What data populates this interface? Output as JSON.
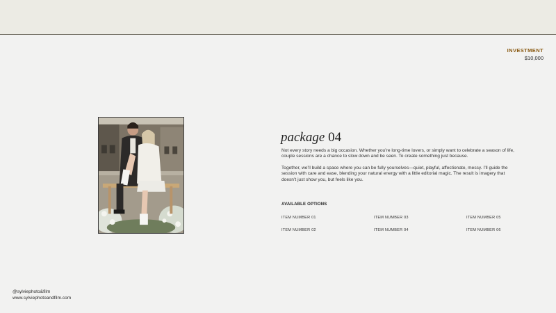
{
  "investment": {
    "label": "INVESTMENT",
    "price": "$10,000"
  },
  "package": {
    "title_script": "package",
    "title_number": "04",
    "paragraph_1": "Not every story needs a big occasion. Whether you’re long-time lovers, or simply want to celebrate a season of life, couple sessions are a chance to slow down and be seen. To create something just because.",
    "paragraph_2": "Together, we’ll build a space where you can be fully yourselves—quiet, playful, affectionate, messy. I’ll guide the session with care and ease, blending your natural energy with a little editorial magic. The result is imagery that doesn’t just show you, but feels like you."
  },
  "options": {
    "title": "AVAILABLE OPTIONS",
    "items": [
      "ITEM NUMBER 01",
      "ITEM NUMBER 02",
      "ITEM NUMBER 03",
      "ITEM NUMBER 04",
      "ITEM NUMBER 05",
      "ITEM NUMBER 06"
    ]
  },
  "footer": {
    "handle": "@sylviephoto&film",
    "website": "www.sylviephotoandfilm.com"
  },
  "photo": {
    "icon": "couple-photo"
  }
}
